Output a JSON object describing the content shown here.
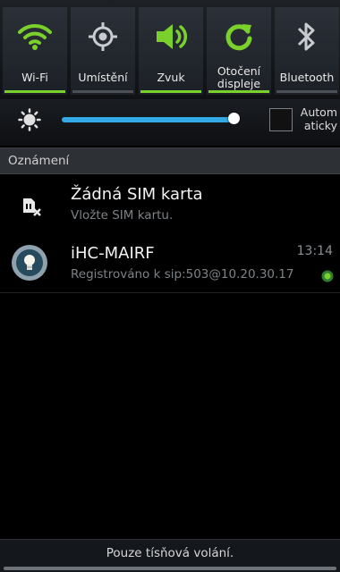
{
  "quick_settings": {
    "tiles": [
      {
        "label": "Wi-Fi",
        "icon": "wifi-icon",
        "active": true
      },
      {
        "label": "Umístění",
        "icon": "location-icon",
        "active": false
      },
      {
        "label": "Zvuk",
        "icon": "sound-icon",
        "active": true
      },
      {
        "label": "Otočení displeje",
        "icon": "rotate-icon",
        "active": true
      },
      {
        "label": "Bluetooth",
        "icon": "bluetooth-icon",
        "active": false
      }
    ],
    "accent_color": "#7bd12c"
  },
  "brightness": {
    "icon": "brightness-icon",
    "level": 0.94,
    "auto_label": "Automaticky",
    "auto_checked": false,
    "slider_color": "#33a9e6"
  },
  "notifications": {
    "header": "Oznámení",
    "items": [
      {
        "icon": "no-sim-icon",
        "title": "Žádná SIM karta",
        "text": "Vložte SIM kartu.",
        "time": ""
      },
      {
        "icon": "lightbulb-app-icon",
        "title": "iHC-MAIRF",
        "text": "Registrováno k sip:503@10.20.30.17",
        "time": "13:14",
        "status_icon": "sip-status-icon"
      }
    ]
  },
  "footer": {
    "text": "Pouze tísňová volání."
  }
}
